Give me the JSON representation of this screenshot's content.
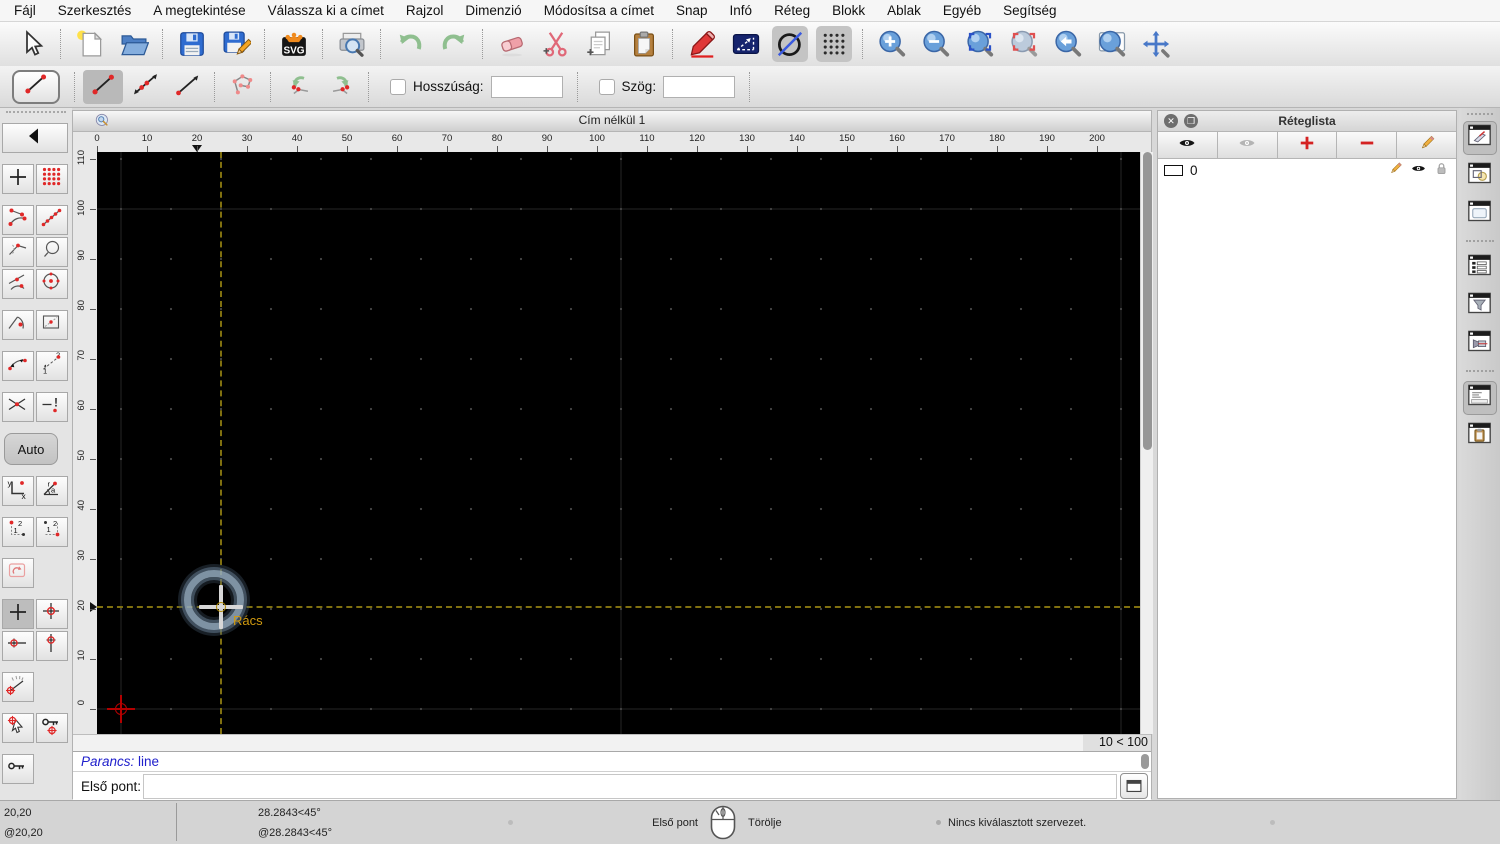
{
  "menu_bar": {
    "items": [
      "Fájl",
      "Szerkesztés",
      "A megtekintése",
      "Válassza ki a címet",
      "Rajzol",
      "Dimenzió",
      "Módosítsa a címet",
      "Snap",
      "Infó",
      "Réteg",
      "Blokk",
      "Ablak",
      "Egyéb",
      "Segítség"
    ]
  },
  "toolbar_main": {
    "buttons": [
      {
        "icon": "cursor",
        "name": "pointer-tool-button"
      },
      {
        "sep": true
      },
      {
        "icon": "new-file",
        "name": "new-drawing-button"
      },
      {
        "icon": "open-folder",
        "name": "open-drawing-button"
      },
      {
        "sep": true
      },
      {
        "icon": "save",
        "name": "save-button"
      },
      {
        "icon": "save-as",
        "name": "save-as-button"
      },
      {
        "sep": true
      },
      {
        "icon": "svg-export",
        "name": "export-svg-button"
      },
      {
        "sep": true
      },
      {
        "icon": "print-preview",
        "name": "print-preview-button"
      },
      {
        "sep": true
      },
      {
        "icon": "undo",
        "name": "undo-button"
      },
      {
        "icon": "redo",
        "name": "redo-button"
      },
      {
        "sep": true
      },
      {
        "icon": "eraser",
        "name": "delete-button"
      },
      {
        "icon": "cut",
        "name": "cut-button"
      },
      {
        "icon": "copy",
        "name": "copy-button"
      },
      {
        "icon": "paste",
        "name": "paste-button"
      },
      {
        "sep": true
      },
      {
        "icon": "pen",
        "name": "pen-button"
      },
      {
        "icon": "selection",
        "name": "selection-button"
      },
      {
        "icon": "draft-mode",
        "name": "draft-mode-button",
        "pressed": true
      },
      {
        "icon": "grid",
        "name": "grid-toggle-button",
        "pressed": true
      },
      {
        "sep": true
      },
      {
        "icon": "zoom-in",
        "name": "zoom-in-button"
      },
      {
        "icon": "zoom-out",
        "name": "zoom-out-button"
      },
      {
        "icon": "zoom-auto",
        "name": "zoom-auto-button"
      },
      {
        "icon": "zoom-selection",
        "name": "zoom-selection-button"
      },
      {
        "icon": "zoom-previous",
        "name": "zoom-previous-button"
      },
      {
        "icon": "zoom-window",
        "name": "zoom-window-button"
      },
      {
        "icon": "pan",
        "name": "pan-button"
      }
    ]
  },
  "toolbar_line": {
    "current_tool_icon": "line",
    "buttons": [
      {
        "icon": "line",
        "name": "line-two-points-button",
        "pressed": true
      },
      {
        "icon": "line-infinite",
        "name": "line-infinite-button"
      },
      {
        "icon": "line-ray",
        "name": "line-ray-button"
      },
      {
        "sep": true
      },
      {
        "icon": "polyline",
        "name": "polyline-button"
      },
      {
        "sep": true
      },
      {
        "icon": "poly-undo",
        "name": "undo-segment-button"
      },
      {
        "icon": "poly-redo",
        "name": "redo-segment-button"
      },
      {
        "sep": true
      }
    ],
    "length_label": "Hosszúság:",
    "length_value": "",
    "angle_label": "Szög:",
    "angle_value": ""
  },
  "snap_sidebar": {
    "back_label": "back",
    "auto_label": "Auto",
    "rows": [
      {
        "buttons": [
          {
            "icon": "back-arrow",
            "name": "snap-back-button",
            "wide": true
          }
        ]
      },
      {
        "gap": true,
        "buttons": [
          {
            "icon": "snap-free",
            "name": "snap-free-button"
          },
          {
            "icon": "snap-grid",
            "name": "snap-grid-button"
          }
        ]
      },
      {
        "gap": true,
        "buttons": [
          {
            "icon": "snap-endpoints",
            "name": "snap-endpoints-button"
          },
          {
            "icon": "snap-points",
            "name": "snap-points-button"
          }
        ]
      },
      {
        "buttons": [
          {
            "icon": "snap-middle",
            "name": "snap-middle-button"
          },
          {
            "icon": "snap-grab",
            "name": "snap-entity-select-button"
          }
        ]
      },
      {
        "buttons": [
          {
            "icon": "snap-tangent",
            "name": "snap-tangent-button"
          },
          {
            "icon": "snap-center",
            "name": "snap-center-button"
          }
        ]
      },
      {
        "gap": true,
        "buttons": [
          {
            "icon": "snap-entity",
            "name": "snap-on-entity-button"
          },
          {
            "icon": "restrict-rect",
            "name": "restrict-orthogonal-button"
          }
        ]
      },
      {
        "gap": true,
        "buttons": [
          {
            "icon": "snap-distance",
            "name": "snap-distance-button"
          },
          {
            "icon": "snap-distance-12",
            "name": "snap-distance-manual-button"
          }
        ]
      },
      {
        "gap": true,
        "buttons": [
          {
            "icon": "intersect-auto",
            "name": "snap-intersection-button"
          },
          {
            "icon": "intersect-manual",
            "name": "snap-intersection-manual-button"
          }
        ]
      },
      {
        "auto": true
      },
      {
        "gap": true,
        "buttons": [
          {
            "icon": "coord-cartesian",
            "name": "coordinate-cartesian-button"
          },
          {
            "icon": "coord-polar",
            "name": "coordinate-polar-button"
          }
        ]
      },
      {
        "gap": true,
        "buttons": [
          {
            "icon": "corner-12",
            "name": "corner-point-1-button"
          },
          {
            "icon": "corner-21",
            "name": "corner-point-2-button"
          }
        ]
      },
      {
        "gap": true,
        "buttons": [
          {
            "icon": "relzero-shape",
            "name": "set-relative-zero-button"
          }
        ]
      },
      {
        "gap": true,
        "buttons": [
          {
            "icon": "snap-free",
            "name": "restrict-nothing-button",
            "pressed": true
          },
          {
            "icon": "cross-target",
            "name": "restrict-none-crosshair-button"
          }
        ]
      },
      {
        "buttons": [
          {
            "icon": "restrict-horizontal",
            "name": "restrict-horizontal-button"
          },
          {
            "icon": "restrict-vertical",
            "name": "restrict-vertical-button"
          }
        ]
      },
      {
        "gap": true,
        "buttons": [
          {
            "icon": "angle-gauge",
            "name": "snap-angle-button"
          }
        ]
      },
      {
        "gap": true,
        "buttons": [
          {
            "icon": "pick-target",
            "name": "pick-relative-zero-button"
          },
          {
            "icon": "key-target",
            "name": "lock-relative-zero-button"
          }
        ]
      },
      {
        "gap": true,
        "buttons": [
          {
            "icon": "key",
            "name": "unlock-relative-zero-button"
          }
        ]
      }
    ]
  },
  "document": {
    "title": "Cím nélkül 1",
    "h_ruler": {
      "labels": [
        "0",
        "10",
        "20",
        "30",
        "40",
        "50",
        "60",
        "70",
        "80",
        "90",
        "100",
        "110",
        "120",
        "130",
        "140",
        "150",
        "160",
        "170",
        "180",
        "190",
        "200"
      ]
    },
    "v_ruler": {
      "labels": [
        "110",
        "100",
        "90",
        "80",
        "70",
        "60",
        "50",
        "40",
        "30",
        "20",
        "10",
        "0"
      ]
    },
    "canvas": {
      "grid_status": "10 < 100",
      "crosshair_label": "Rács"
    }
  },
  "command_dock": {
    "history_prefix": "Parancs:",
    "history_command": "line",
    "prompt_label": "Első pont:",
    "input_value": ""
  },
  "layer_panel": {
    "title": "Réteglista",
    "close_glyph": "✕",
    "float_glyph": "❐",
    "toolbar": [
      {
        "icon": "eye-black",
        "name": "show-all-layers-button"
      },
      {
        "icon": "eye-gray",
        "name": "hide-all-layers-button"
      },
      {
        "icon": "plus-red",
        "name": "add-layer-button"
      },
      {
        "icon": "minus-red",
        "name": "remove-layer-button"
      },
      {
        "icon": "pencil",
        "name": "edit-layer-button"
      }
    ],
    "layers": [
      {
        "name": "0",
        "visible": true,
        "locked": false
      }
    ]
  },
  "right_dock": {
    "items": [
      {
        "icon": "dock-layers",
        "name": "toggle-layer-list-button",
        "pressed": true
      },
      {
        "icon": "dock-blocks",
        "name": "toggle-block-list-button"
      },
      {
        "icon": "dock-library",
        "name": "toggle-library-browser-button"
      },
      {
        "sep": true
      },
      {
        "icon": "dock-entities",
        "name": "toggle-entity-list-button"
      },
      {
        "icon": "dock-filter",
        "name": "toggle-entity-filter-button"
      },
      {
        "icon": "dock-views",
        "name": "toggle-named-views-button"
      },
      {
        "sep": true
      },
      {
        "icon": "dock-command",
        "name": "toggle-command-widget-button",
        "pressed": true
      },
      {
        "icon": "dock-clipboard",
        "name": "toggle-clipboard-button"
      }
    ]
  },
  "status_bar": {
    "abs_coord": "20,20",
    "rel_coord": "@20,20",
    "abs_polar": "28.2843<45°",
    "rel_polar": "@28.2843<45°",
    "left_click_label": "Első pont",
    "right_click_label": "Törölje",
    "selection_status": "Nincs kiválasztott szervezet."
  }
}
